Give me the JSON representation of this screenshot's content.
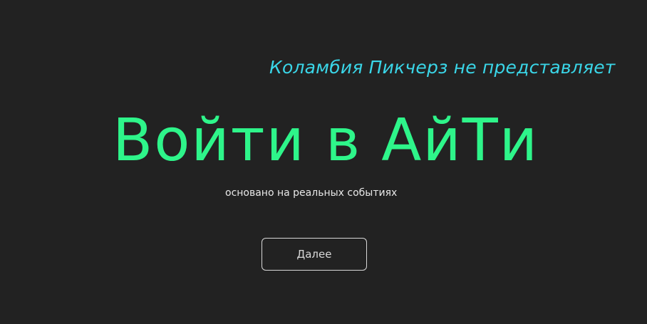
{
  "presenter_line": "Коламбия Пикчерз не представляет",
  "title": "Войти в АйТи",
  "tagline": "основано на реальных событиях",
  "next_button": "Далее",
  "colors": {
    "background": "#222222",
    "presenter_text": "#3ad6e8",
    "title_text": "#2ef58a",
    "tagline_text": "#e8e8e8",
    "button_border": "#d8d8d8"
  }
}
